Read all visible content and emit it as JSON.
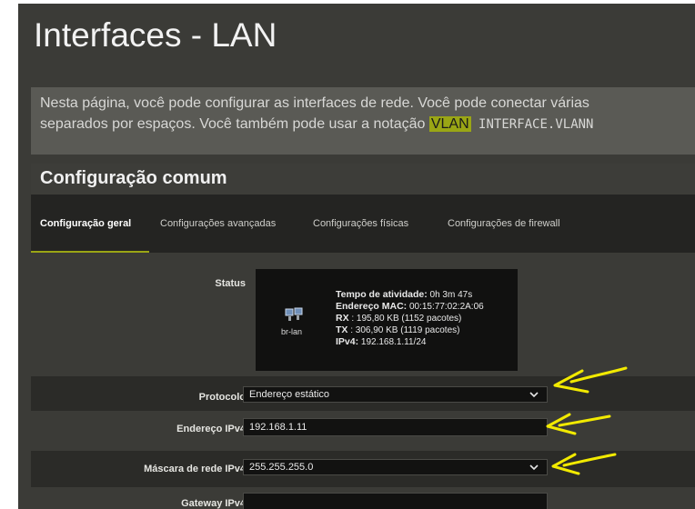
{
  "page": {
    "title": "Interfaces - LAN",
    "description_line1": "Nesta página, você pode configurar as interfaces de rede. Você pode conectar várias",
    "description_line2_pre": "separados por espaços. Você também pode usar a notação ",
    "description_line2_highlight": "VLAN",
    "description_line2_mono": " INTERFACE.VLANN"
  },
  "section": {
    "title": "Configuração comum",
    "tabs": [
      {
        "label": "Configuração geral",
        "active": true
      },
      {
        "label": "Configurações avançadas",
        "active": false
      },
      {
        "label": "Configurações físicas",
        "active": false
      },
      {
        "label": "Configurações de firewall",
        "active": false
      }
    ]
  },
  "status": {
    "label": "Status",
    "interface": "br-lan",
    "uptime_label": "Tempo de atividade:",
    "uptime_value": "0h 3m 47s",
    "mac_label": "Endereço MAC:",
    "mac_value": "00:15:77:02:2A:06",
    "rx_label": "RX",
    "rx_value": ": 195,80 KB (1152 pacotes)",
    "tx_label": "TX",
    "tx_value": ": 306,90 KB (1119 pacotes)",
    "ipv4_label": "IPv4:",
    "ipv4_value": "192.168.1.11/24"
  },
  "form": {
    "protocol": {
      "label": "Protocolo",
      "value": "Endereço estático"
    },
    "ipv4_address": {
      "label": "Endereço IPv4",
      "value": "192.168.1.11"
    },
    "netmask": {
      "label": "Máscara de rede IPv4",
      "value": "255.255.255.0"
    },
    "gateway": {
      "label": "Gateway IPv4",
      "value": ""
    }
  },
  "colors": {
    "accent": "#9aa615",
    "annotation": "#f2ea00"
  }
}
